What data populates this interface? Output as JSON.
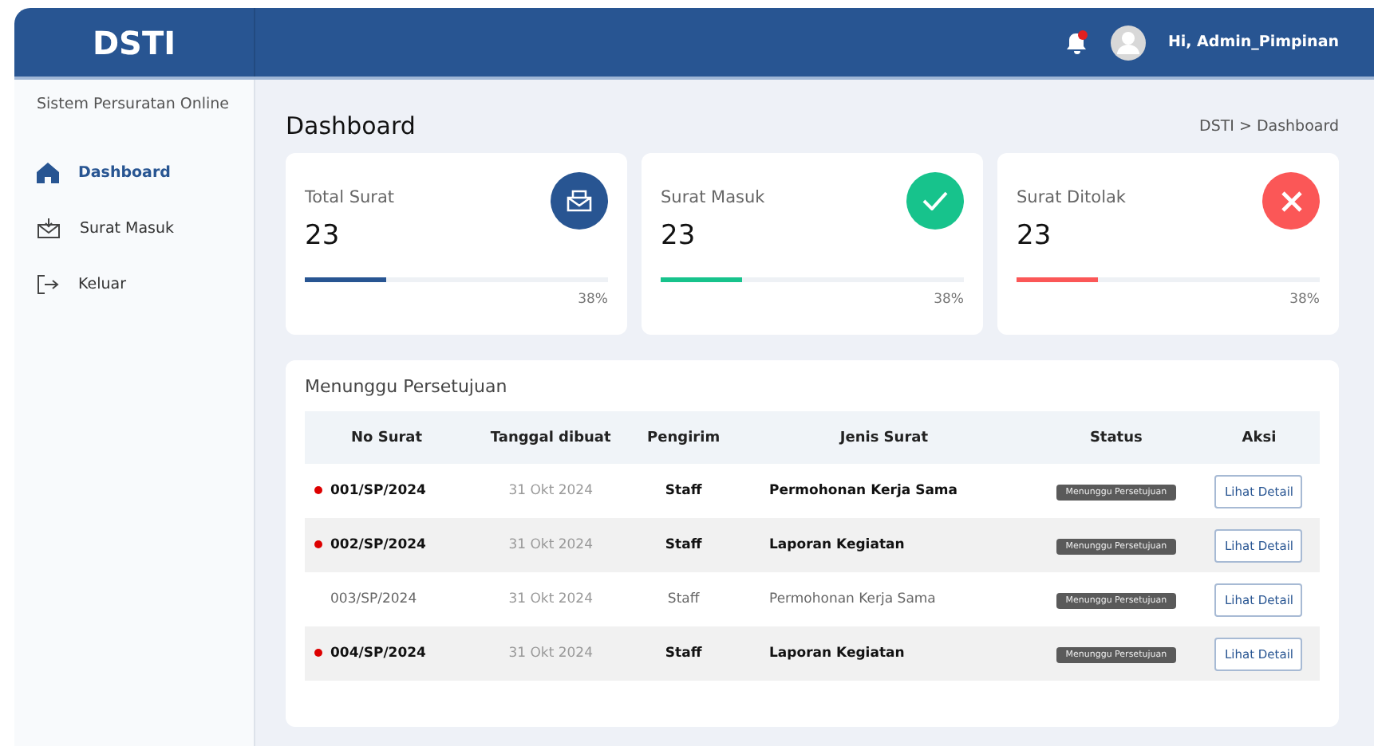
{
  "brand": "DSTI",
  "header": {
    "greeting": "Hi, Admin_Pimpinan",
    "has_notification": true
  },
  "sidebar": {
    "subtitle": "Sistem Persuratan Online",
    "items": [
      {
        "label": "Dashboard",
        "kind": "home",
        "selected": true
      },
      {
        "label": "Surat Masuk",
        "kind": "inbox",
        "selected": false
      },
      {
        "label": "Keluar",
        "kind": "logout",
        "selected": false
      }
    ]
  },
  "page": {
    "title": "Dashboard",
    "breadcrumb": "DSTI > Dashboard"
  },
  "stats": [
    {
      "label": "Total Surat",
      "value": "23",
      "percent": "38%",
      "level": 0.27,
      "kind": "total",
      "color": "#285592"
    },
    {
      "label": "Surat Masuk",
      "value": "23",
      "percent": "38%",
      "level": 0.27,
      "kind": "accepted",
      "color": "#17c38c"
    },
    {
      "label": "Surat Ditolak",
      "value": "23",
      "percent": "38%",
      "level": 0.27,
      "kind": "rejected",
      "color": "#fb5757"
    }
  ],
  "table": {
    "title": "Menunggu Persetujuan",
    "columns": [
      "No Surat",
      "Tanggal dibuat",
      "Pengirim",
      "Jenis Surat",
      "Status",
      "Aksi"
    ],
    "rows": [
      {
        "no": "001/SP/2024",
        "date": "31 Okt 2024",
        "sender": "Staff",
        "type": "Permohonan Kerja Sama",
        "status": "Menunggu Persetujuan",
        "action": "Lihat Detail",
        "unread": true
      },
      {
        "no": "002/SP/2024",
        "date": "31 Okt 2024",
        "sender": "Staff",
        "type": "Laporan Kegiatan",
        "status": "Menunggu Persetujuan",
        "action": "Lihat Detail",
        "unread": true
      },
      {
        "no": "003/SP/2024",
        "date": "31 Okt 2024",
        "sender": "Staff",
        "type": "Permohonan Kerja Sama",
        "status": "Menunggu Persetujuan",
        "action": "Lihat Detail",
        "unread": false
      },
      {
        "no": "004/SP/2024",
        "date": "31 Okt 2024",
        "sender": "Staff",
        "type": "Laporan Kegiatan",
        "status": "Menunggu Persetujuan",
        "action": "Lihat Detail",
        "unread": true
      }
    ]
  }
}
